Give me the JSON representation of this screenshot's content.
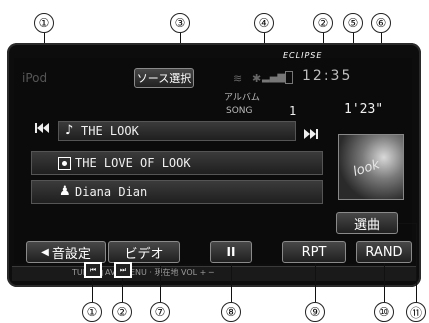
{
  "header": {
    "source": "iPod",
    "source_select_button": "ソース選択",
    "brand": "ECLIPSE",
    "clock": "12:35"
  },
  "track": {
    "album_label": "アルバム",
    "song_label": "SONG",
    "song_number": "1",
    "time": "1'23\"",
    "title": "THE LOOK",
    "album": "THE LOVE OF LOOK",
    "artist": "Diana Dian"
  },
  "buttons": {
    "prev_icon": "skip-back-icon",
    "next_icon": "skip-forward-icon",
    "sound_setting": "音設定",
    "video": "ビデオ",
    "pause": "II",
    "rpt": "RPT",
    "rand": "RAND",
    "song_select": "選曲"
  },
  "bottom_bar": {
    "text": "TUNE  ◀  AV · MENU · 現在地   VOL  +  ─"
  },
  "callouts": [
    "①",
    "②",
    "③",
    "④",
    "⑤",
    "⑥",
    "⑦",
    "⑧",
    "⑨",
    "⑩",
    "⑪"
  ]
}
